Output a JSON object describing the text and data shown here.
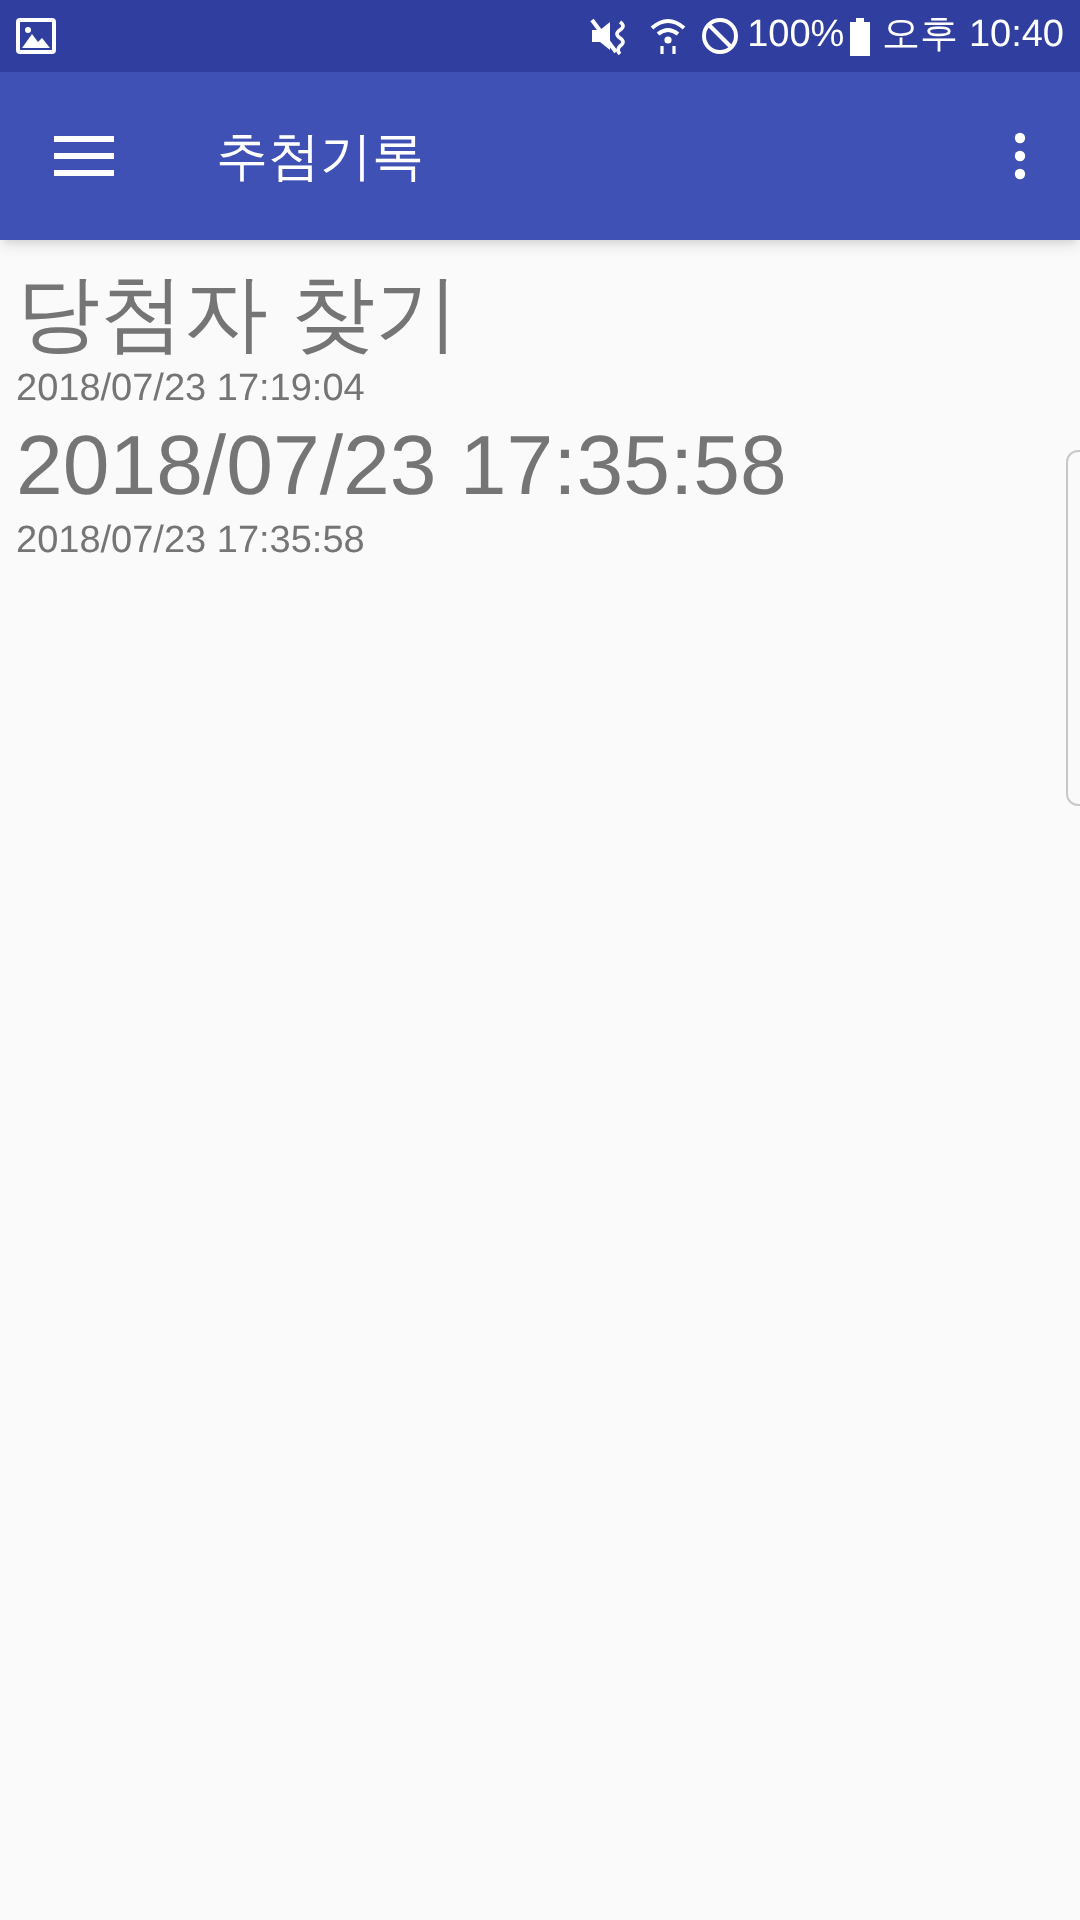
{
  "status_bar": {
    "battery": "100%",
    "time": "오후 10:40"
  },
  "app_bar": {
    "title": "추첨기록"
  },
  "records": [
    {
      "title": "당첨자 찾기",
      "timestamp": "2018/07/23 17:19:04"
    },
    {
      "title": "2018/07/23 17:35:58",
      "timestamp": "2018/07/23 17:35:58"
    }
  ]
}
